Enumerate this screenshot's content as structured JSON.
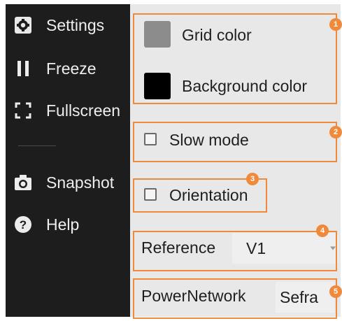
{
  "sidebar": {
    "items": [
      {
        "label": "Settings",
        "icon": "gear-icon"
      },
      {
        "label": "Freeze",
        "icon": "pause-icon"
      },
      {
        "label": "Fullscreen",
        "icon": "fullscreen-icon"
      },
      {
        "label": "Snapshot",
        "icon": "camera-icon"
      },
      {
        "label": "Help",
        "icon": "help-icon"
      }
    ]
  },
  "settings": {
    "grid_color_label": "Grid color",
    "grid_color": "#8c8c8c",
    "background_color_label": "Background color",
    "background_color": "#000000",
    "slow_mode_label": "Slow mode",
    "slow_mode_checked": false,
    "orientation_label": "Orientation",
    "orientation_checked": false,
    "reference_label": "Reference",
    "reference_value": "V1",
    "power_network_label": "PowerNetwork",
    "power_network_value": "Sefra"
  },
  "annotations": [
    "1",
    "2",
    "3",
    "4",
    "5"
  ],
  "colors": {
    "sidebar_bg": "#1d1d1d",
    "panel_bg": "#e8e8e8",
    "annotation": "#f08a3a"
  }
}
